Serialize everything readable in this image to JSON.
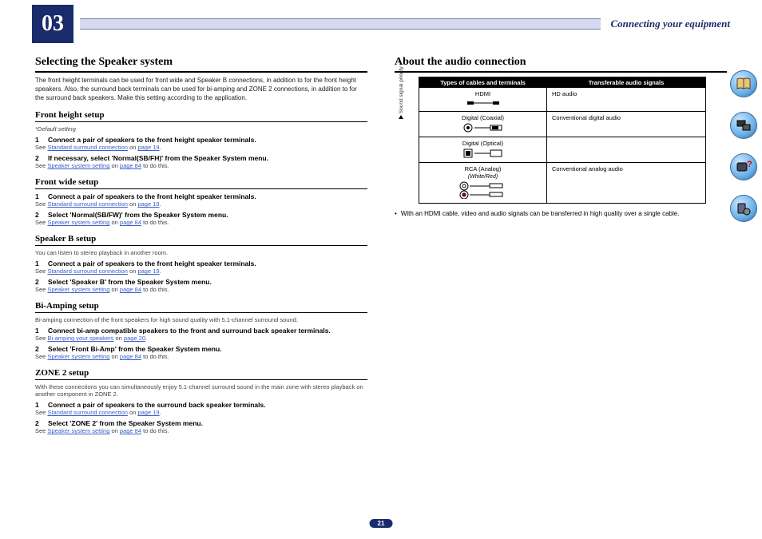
{
  "chapter": {
    "num": "03",
    "title": "Connecting your equipment"
  },
  "pagenum": "21",
  "nav": [
    "book-icon",
    "equipment-icon",
    "help-icon",
    "config-icon"
  ],
  "left": {
    "h": "Selecting the Speaker system",
    "intro": "The front height terminals can be used for front wide and Speaker B connections, in addition to for the front height speakers. Also, the surround back terminals can be used for bi-amping and ZONE 2 connections, in addition to for the surround back speakers. Make this setting according to the application.",
    "sections": [
      {
        "h": "Front height setup",
        "note": "*Default setting",
        "steps": [
          {
            "n": "1",
            "t": "Connect a pair of speakers to the front height speaker terminals.",
            "ref": "Standard surround connection",
            "page": "page 19",
            "tail": "."
          },
          {
            "n": "2",
            "t": "If necessary, select 'Normal(SB/FH)' from the Speaker System menu.",
            "ref": "Speaker system setting",
            "page": "page 84",
            "tail": " to do this."
          }
        ]
      },
      {
        "h": "Front wide setup",
        "steps": [
          {
            "n": "1",
            "t": "Connect a pair of speakers to the front height speaker terminals.",
            "ref": "Standard surround connection",
            "page": "page 19",
            "tail": "."
          },
          {
            "n": "2",
            "t": "Select 'Normal(SB/FW)' from the Speaker System menu.",
            "ref": "Speaker system setting",
            "page": "page 84",
            "tail": " to do this."
          }
        ]
      },
      {
        "h": "Speaker B setup",
        "note2": "You can listen to stereo playback in another room.",
        "steps": [
          {
            "n": "1",
            "t": "Connect a pair of speakers to the front height speaker terminals.",
            "ref": "Standard surround connection",
            "page": "page 19",
            "tail": "."
          },
          {
            "n": "2",
            "t": "Select 'Speaker B' from the Speaker System menu.",
            "ref": "Speaker system setting",
            "page": "page 84",
            "tail": " to do this."
          }
        ]
      },
      {
        "h": "Bi-Amping setup",
        "note2": "Bi-amping connection of the front speakers for high sound quality with 5.1-channel surround sound.",
        "steps": [
          {
            "n": "1",
            "t": "Connect bi-amp compatible speakers to the front and surround back speaker terminals.",
            "ref": "Bi-amping your speakers",
            "page": "page 20",
            "tail": "."
          },
          {
            "n": "2",
            "t": "Select 'Front Bi-Amp' from the Speaker System menu.",
            "ref": "Speaker system setting",
            "page": "page 84",
            "tail": " to do this."
          }
        ]
      },
      {
        "h": "ZONE 2 setup",
        "note2": "With these connections you can simultaneously enjoy 5.1-channel surround sound in the main zone with stereo playback on another component in ZONE 2.",
        "steps": [
          {
            "n": "1",
            "t": "Connect a pair of speakers to the surround back speaker terminals.",
            "ref": "Standard surround connection",
            "page": "page 19",
            "tail": "."
          },
          {
            "n": "2",
            "t": "Select 'ZONE 2' from the Speaker System menu.",
            "ref": "Speaker system setting",
            "page": "page 84",
            "tail": " to do this."
          }
        ]
      }
    ],
    "see": "See "
  },
  "right": {
    "h": "About the audio connection",
    "hdr1": "Types of cables and terminals",
    "hdr2": "Transferable audio signals",
    "rot": "Sound signal priority",
    "rows": [
      {
        "t": "HDMI",
        "s": "HD audio",
        "icon": "hdmi"
      },
      {
        "t": "Digital (Coaxial)",
        "s": "Conventional digital audio",
        "icon": "coax"
      },
      {
        "t": "Digital (Optical)",
        "s": "",
        "icon": "opt"
      },
      {
        "t": "RCA (Analog)",
        "sub": "(White/Red)",
        "s": "Conventional analog audio",
        "icon": "rca"
      }
    ],
    "bullet": "With an HDMI cable, video and audio signals can be transferred in high quality over a single cable."
  }
}
